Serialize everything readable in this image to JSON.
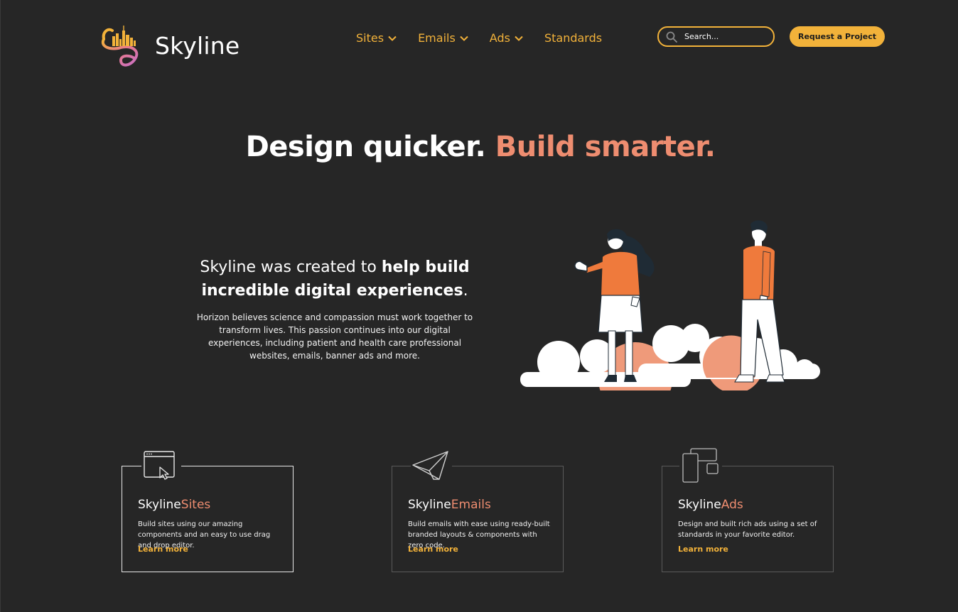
{
  "header": {
    "logo_text": "Skyline",
    "nav": [
      {
        "label": "Sites",
        "has_dropdown": true
      },
      {
        "label": "Emails",
        "has_dropdown": true
      },
      {
        "label": "Ads",
        "has_dropdown": true
      },
      {
        "label": "Standards",
        "has_dropdown": false
      }
    ],
    "search_placeholder": "Search...",
    "cta_label": "Request a Project"
  },
  "hero": {
    "title_main": "Design quicker. ",
    "title_accent": "Build smarter."
  },
  "intro": {
    "lead_pre": "Skyline was created to ",
    "lead_bold": "help build incredible digital experiences",
    "lead_post": ".",
    "body": "Horizon believes science and compassion must work together to transform lives. This passion continues into our digital experiences, including patient and health care professional websites, emails, banner ads and more."
  },
  "cards": [
    {
      "brand": "Skyline",
      "product": "Sites",
      "description": "Build sites using our amazing components and an easy to use drag and drop editor.",
      "link": "Learn more",
      "icon": "browser-cursor-icon",
      "active": true
    },
    {
      "brand": "Skyline",
      "product": "Emails",
      "description": "Build emails with ease using ready-built branded layouts & components with zero code.",
      "link": "Learn more",
      "icon": "paper-plane-icon",
      "active": false
    },
    {
      "brand": "Skyline",
      "product": "Ads",
      "description": "Design and built rich ads using a set of standards in your favorite editor.",
      "link": "Learn more",
      "icon": "ad-layouts-icon",
      "active": false
    }
  ],
  "colors": {
    "background": "#262626",
    "accent_yellow": "#f2b23a",
    "accent_salmon": "#ee8d70",
    "illustration_orange": "#ef7a3c"
  }
}
